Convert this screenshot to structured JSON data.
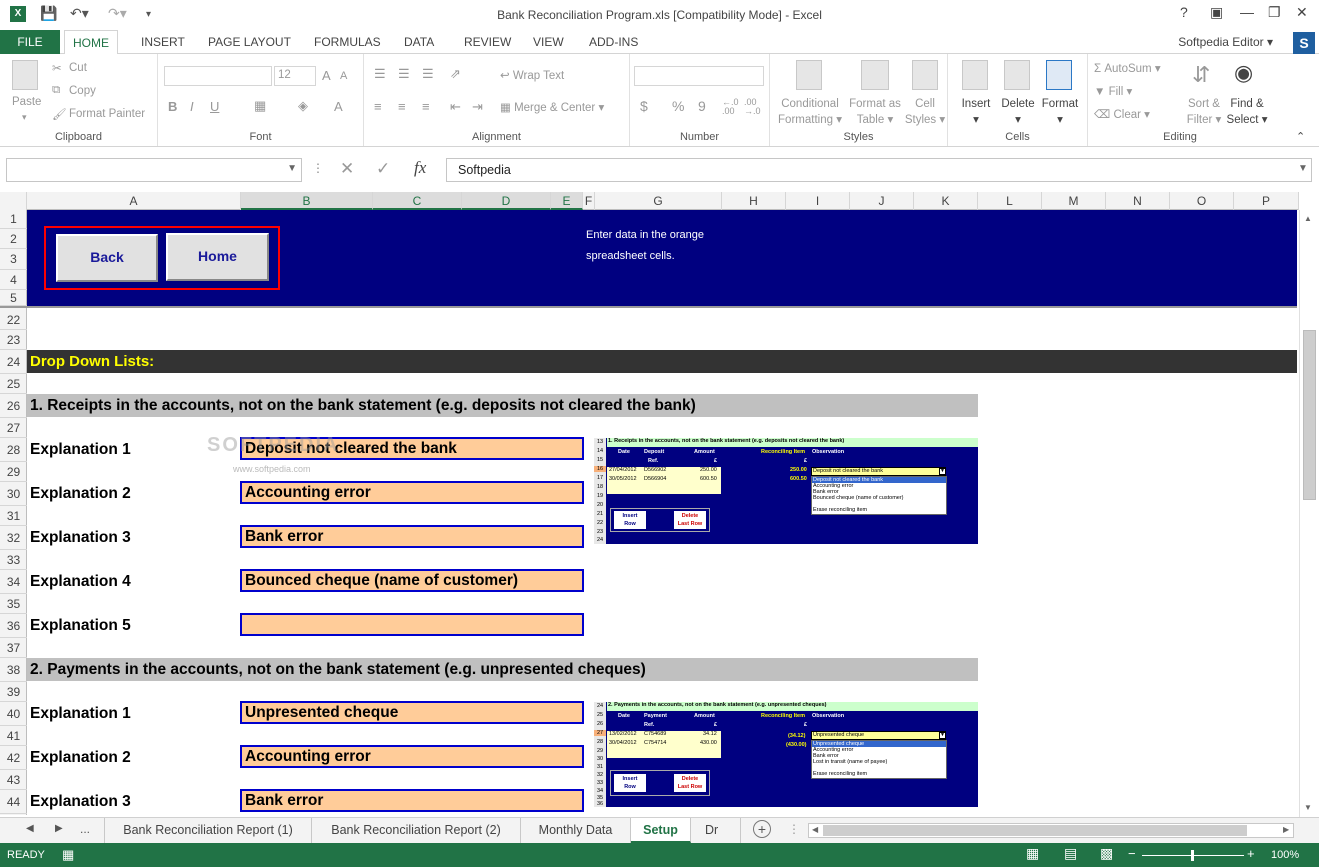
{
  "window": {
    "title": "Bank Reconciliation Program.xls  [Compatibility Mode] - Excel",
    "help": "?",
    "minimize": "—",
    "restore": "❐",
    "close": "✕"
  },
  "ribbon_tabs": {
    "file": "FILE",
    "tabs": [
      "HOME",
      "INSERT",
      "PAGE LAYOUT",
      "FORMULAS",
      "DATA",
      "REVIEW",
      "VIEW",
      "ADD-INS"
    ],
    "active": "HOME",
    "user": "Softpedia Editor",
    "user_logo": "S"
  },
  "ribbon": {
    "clipboard": {
      "paste": "Paste",
      "cut": "Cut",
      "copy": "Copy",
      "format_painter": "Format Painter",
      "name": "Clipboard"
    },
    "font": {
      "size": "12",
      "bold": "B",
      "italic": "I",
      "underline": "U",
      "grow": "A",
      "shrink": "A",
      "font_color": "A",
      "name": "Font"
    },
    "alignment": {
      "wrap": "Wrap Text",
      "merge": "Merge & Center",
      "name": "Alignment"
    },
    "number": {
      "currency": "$",
      "percent": "%",
      "comma": "9",
      "name": "Number"
    },
    "styles": {
      "conditional_1": "Conditional",
      "conditional_2": "Formatting",
      "format_as_1": "Format as",
      "format_as_2": "Table",
      "cell_1": "Cell",
      "cell_2": "Styles",
      "name": "Styles"
    },
    "cells": {
      "insert": "Insert",
      "delete": "Delete",
      "format": "Format",
      "name": "Cells"
    },
    "editing": {
      "autosum": "AutoSum",
      "fill": "Fill",
      "clear": "Clear",
      "sort_1": "Sort &",
      "sort_2": "Filter",
      "find_1": "Find &",
      "find_2": "Select",
      "name": "Editing"
    }
  },
  "formula_bar": {
    "name_box": "",
    "fx": "fx",
    "value": "Softpedia"
  },
  "columns": [
    "A",
    "B",
    "C",
    "D",
    "E",
    "F",
    "G",
    "H",
    "I",
    "J",
    "K",
    "L",
    "M",
    "N",
    "O",
    "P"
  ],
  "rows": [
    "1",
    "2",
    "3",
    "4",
    "5",
    "22",
    "23",
    "24",
    "25",
    "26",
    "27",
    "28",
    "29",
    "30",
    "31",
    "32",
    "33",
    "34",
    "35",
    "36",
    "37",
    "38",
    "39",
    "40",
    "41",
    "42",
    "43",
    "44"
  ],
  "sheet": {
    "back_button": "Back",
    "home_button": "Home",
    "note_line1": "Enter data in the orange",
    "note_line2": "spreadsheet cells.",
    "dropdown_header": "Drop Down Lists:",
    "section1": {
      "title": "1. Receipts in the accounts, not on the bank statement (e.g. deposits not cleared the bank)",
      "items": [
        {
          "label": "Explanation 1",
          "value": "Deposit not cleared the bank"
        },
        {
          "label": "Explanation 2",
          "value": "Accounting error"
        },
        {
          "label": "Explanation 3",
          "value": "Bank error"
        },
        {
          "label": "Explanation 4",
          "value": "Bounced cheque (name of customer)"
        },
        {
          "label": "Explanation 5",
          "value": ""
        }
      ]
    },
    "section2": {
      "title": "2. Payments in the accounts, not on the bank statement (e.g. unpresented cheques)",
      "items": [
        {
          "label": "Explanation 1",
          "value": "Unpresented cheque"
        },
        {
          "label": "Explanation 2",
          "value": "Accounting error"
        },
        {
          "label": "Explanation 3",
          "value": "Bank error"
        }
      ]
    },
    "watermark": "SOFTPEDIA",
    "watermark_url": "www.softpedia.com",
    "thumb1": {
      "title": "1. Receipts in the accounts, not on the bank statement (e.g. deposits not cleared the bank)",
      "rows": [
        "13",
        "14",
        "15",
        "16",
        "17",
        "18",
        "19",
        "20",
        "21",
        "22",
        "23",
        "24"
      ],
      "headers": [
        "Date",
        "Deposit",
        "Amount",
        "Reconciling Item",
        "Observation"
      ],
      "subheaders": [
        "Ref.",
        "£",
        "£"
      ],
      "entries": [
        {
          "date": "27/04/2012",
          "ref": "D566902",
          "amount": "250.00",
          "recon": "250.00"
        },
        {
          "date": "30/05/2012",
          "ref": "D566904",
          "amount": "600.50",
          "recon": "600.50"
        }
      ],
      "selected": "Deposit not cleared the bank",
      "options": [
        "Deposit not cleared the bank",
        "Accounting error",
        "Bank error",
        "Bounced cheque (name of customer)",
        "",
        "Erase reconciling item"
      ],
      "insert_btn": [
        "Insert",
        "Row"
      ],
      "delete_btn": [
        "Delete",
        "Last Row"
      ]
    },
    "thumb2": {
      "title": "2. Payments in the accounts, not on the bank statement (e.g. unpresented cheques)",
      "rows": [
        "24",
        "25",
        "26",
        "27",
        "28",
        "29",
        "30",
        "31",
        "32",
        "33",
        "34",
        "35",
        "36"
      ],
      "headers": [
        "Date",
        "Payment",
        "Amount",
        "Reconciling Item",
        "Observation"
      ],
      "subheaders": [
        "Ref.",
        "£",
        "£"
      ],
      "entries": [
        {
          "date": "13/02/2012",
          "ref": "C754689",
          "amount": "34.12",
          "recon": "(34.12)"
        },
        {
          "date": "30/04/2012",
          "ref": "C754714",
          "amount": "430.00",
          "recon": "(430.00)"
        }
      ],
      "selected": "Unpresented cheque",
      "options": [
        "Unpresented cheque",
        "Accounting error",
        "Bank error",
        "Lost in transit (name of payee)",
        "",
        "Erase reconciling item"
      ],
      "insert_btn": [
        "Insert",
        "Row"
      ],
      "delete_btn": [
        "Delete",
        "Last Row"
      ]
    }
  },
  "sheet_tabs": {
    "more": "...",
    "tabs": [
      "Bank Reconciliation Report (1)",
      "Bank Reconciliation Report (2)",
      "Monthly Data",
      "Setup",
      "Dr"
    ],
    "active": "Setup",
    "add": "+"
  },
  "status": {
    "state": "READY",
    "zoom": "100%"
  },
  "colors": {
    "excel_green": "#217346",
    "navy": "#000080",
    "orange_cell": "#ffcc99",
    "yellow": "#ffff00"
  }
}
